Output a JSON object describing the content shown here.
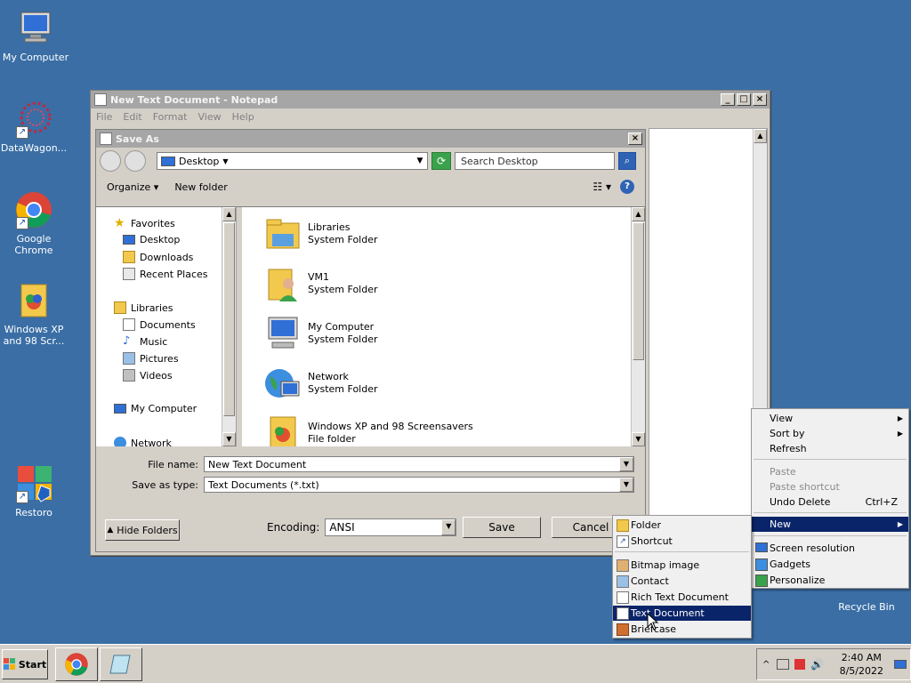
{
  "desktop": {
    "icons": [
      {
        "label": "My Computer"
      },
      {
        "label": "DataWagon..."
      },
      {
        "label": "Google Chrome"
      },
      {
        "label": "Windows XP and 98 Scr..."
      },
      {
        "label": "Restoro"
      },
      {
        "label": "Recycle Bin"
      }
    ]
  },
  "notepad": {
    "title": "New Text Document - Notepad",
    "menu": [
      "File",
      "Edit",
      "Format",
      "View",
      "Help"
    ]
  },
  "save_as": {
    "title": "Save As",
    "address": "Desktop",
    "search_placeholder": "Search Desktop",
    "organize_label": "Organize",
    "new_folder_label": "New folder",
    "nav": {
      "favorites": "Favorites",
      "desktop": "Desktop",
      "downloads": "Downloads",
      "recent": "Recent Places",
      "libraries": "Libraries",
      "documents": "Documents",
      "music": "Music",
      "pictures": "Pictures",
      "videos": "Videos",
      "my_computer": "My Computer",
      "network": "Network"
    },
    "files": [
      {
        "name": "Libraries",
        "type": "System Folder"
      },
      {
        "name": "VM1",
        "type": "System Folder"
      },
      {
        "name": "My Computer",
        "type": "System Folder"
      },
      {
        "name": "Network",
        "type": "System Folder"
      },
      {
        "name": "Windows XP and 98 Screensavers",
        "type": "File folder"
      }
    ],
    "file_name_label": "File name:",
    "file_name_value": "New Text Document",
    "save_type_label": "Save as type:",
    "save_type_value": "Text Documents (*.txt)",
    "encoding_label": "Encoding:",
    "encoding_value": "ANSI",
    "hide_folders_label": "Hide Folders",
    "save_label": "Save",
    "cancel_label": "Cancel"
  },
  "desktop_menu": {
    "view": "View",
    "sort_by": "Sort by",
    "refresh": "Refresh",
    "paste": "Paste",
    "paste_shortcut": "Paste shortcut",
    "undo_delete": "Undo Delete",
    "undo_shortcut": "Ctrl+Z",
    "new": "New",
    "screen_resolution": "Screen resolution",
    "gadgets": "Gadgets",
    "personalize": "Personalize"
  },
  "new_submenu": {
    "folder": "Folder",
    "shortcut": "Shortcut",
    "bitmap": "Bitmap image",
    "contact": "Contact",
    "rtf": "Rich Text Document",
    "text": "Text Document",
    "briefcase": "Briefcase"
  },
  "taskbar": {
    "start_label": "Start",
    "time": "2:40 AM",
    "date": "8/5/2022"
  },
  "colors": {
    "desktop": "#3a6ea5",
    "menu_highlight": "#0a246a",
    "chrome_red": "#db4437",
    "chrome_green": "#0f9d58",
    "chrome_yellow": "#f4b400",
    "chrome_blue": "#4285f4"
  }
}
